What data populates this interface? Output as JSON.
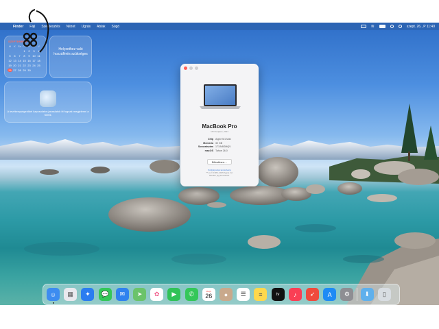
{
  "menubar": {
    "apple_glyph": "",
    "items": [
      "Finder",
      "Fájl",
      "Szerkesztés",
      "Nézet",
      "Ugrás",
      "Ablak",
      "Súgó"
    ],
    "clock": "szept. 26., P 11:40"
  },
  "widgets": {
    "calendar": {
      "month": "SZEPTEMBER",
      "weekdays": [
        "H",
        "K",
        "Sz",
        "Cs",
        "P",
        "Sz",
        "V"
      ],
      "days": [
        "",
        "",
        "",
        "1",
        "2",
        "3",
        "4",
        "5",
        "6",
        "7",
        "8",
        "9",
        "10",
        "11",
        "12",
        "13",
        "14",
        "15",
        "16",
        "17",
        "18",
        "19",
        "20",
        "21",
        "22",
        "23",
        "24",
        "25",
        "26",
        "27",
        "28",
        "29",
        "30",
        "",
        ""
      ],
      "today": "26"
    },
    "location": {
      "text": "Helyzethez való hozzáférés szükséges"
    },
    "siri": {
      "text": "A tevékenységeiddel kapcsolatos javaslatok itt fognak megjelenni a Siritől."
    }
  },
  "about": {
    "model": "MacBook Pro",
    "subtitle": "16 hüvelykes, 2021",
    "specs": [
      {
        "key": "Chip",
        "value": "Apple M1 Max"
      },
      {
        "key": "Memória",
        "value": "32 GB"
      },
      {
        "key": "Sorozatszám",
        "value": "171/N8GMQV"
      },
      {
        "key": "macOS",
        "value": "Tahoe 26.0"
      }
    ],
    "more_button": "Bővebben…",
    "footer_link": "Szabályozási tanúsítvány",
    "footer_copyright": "™ és © 1983–2025 Apple Inc.",
    "footer_rights": "Minden jog fenntartva."
  },
  "dock": {
    "items": [
      {
        "name": "finder-icon",
        "color": "#3d8cf0"
      },
      {
        "name": "launchpad-icon",
        "color": "#e9e9ee"
      },
      {
        "name": "safari-icon",
        "color": "#2b7df0"
      },
      {
        "name": "messages-icon",
        "color": "#34c759"
      },
      {
        "name": "mail-icon",
        "color": "#2f82ef"
      },
      {
        "name": "maps-icon",
        "color": "#6bc36a"
      },
      {
        "name": "photos-icon",
        "color": "#ffffff"
      },
      {
        "name": "facetime-icon",
        "color": "#30c257"
      },
      {
        "name": "phone-icon",
        "color": "#34c759"
      },
      {
        "name": "calendar-icon",
        "color": "#ffffff"
      },
      {
        "name": "contacts-icon",
        "color": "#c9a98c"
      },
      {
        "name": "reminders-icon",
        "color": "#ffffff"
      },
      {
        "name": "notes-icon",
        "color": "#ffd84d"
      },
      {
        "name": "tv-icon",
        "color": "#111111"
      },
      {
        "name": "music-icon",
        "color": "#fa3f55"
      },
      {
        "name": "rocket-icon",
        "color": "#f04a3c"
      },
      {
        "name": "app-store-icon",
        "color": "#1e8bf5"
      },
      {
        "name": "system-settings-icon",
        "color": "#8e8e93"
      },
      {
        "name": "downloads-folder-icon",
        "color": "#5fb0ec"
      },
      {
        "name": "trash-icon",
        "color": "#d8dde2"
      }
    ],
    "calendar_month": "szept.",
    "calendar_day": "26",
    "tv_label": "tv"
  }
}
